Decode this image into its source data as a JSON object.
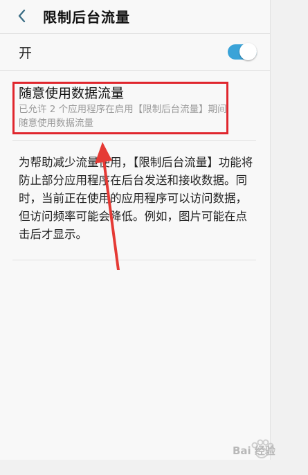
{
  "header": {
    "title": "限制后台流量"
  },
  "toggle_row": {
    "label": "开",
    "state": "on",
    "accent_color": "#3aa3d8"
  },
  "option": {
    "title": "随意使用数据流量",
    "subtitle": "已允许 2 个应用程序在启用【限制后台流量】期间随意使用数据流量"
  },
  "description": "为帮助减少流量使用，【限制后台流量】功能将防止部分应用程序在后台发送和接收数据。同时，当前正在使用的应用程序可以访问数据，但访问频率可能会降低。例如，图片可能在点击后才显示。",
  "annotations": {
    "highlight_color": "#e0262d",
    "arrow_color": "#e53a35"
  },
  "watermark": {
    "text": "Bai 经验"
  }
}
